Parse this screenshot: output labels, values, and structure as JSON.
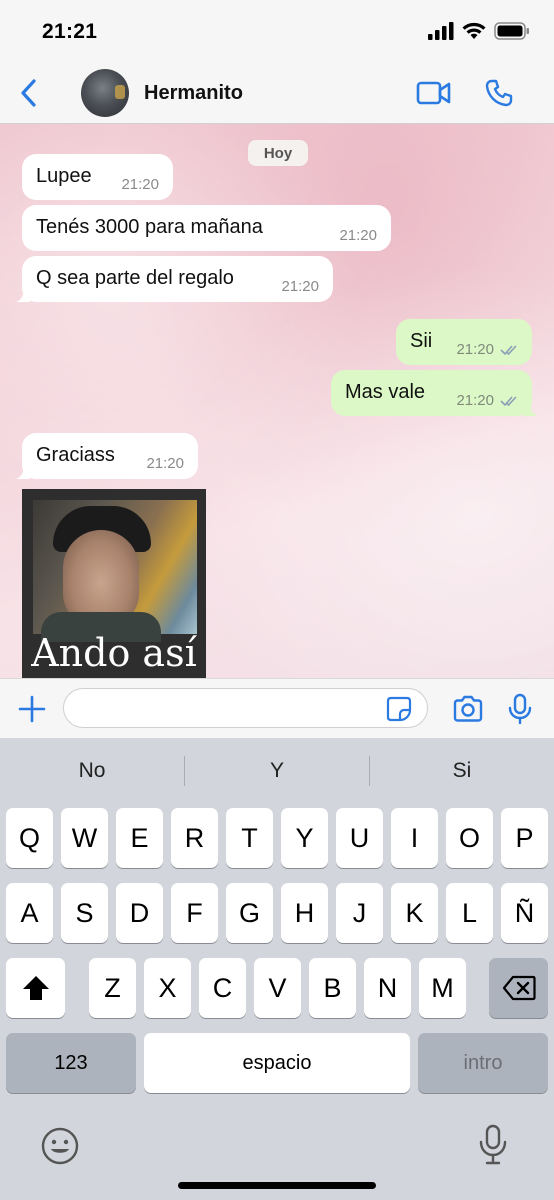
{
  "status_bar": {
    "time": "21:21"
  },
  "header": {
    "contact_name": "Hermanito"
  },
  "chat": {
    "date_chip": "Hoy",
    "messages": [
      {
        "direction": "incoming",
        "text": "Lupee",
        "time": "21:20"
      },
      {
        "direction": "incoming",
        "text": "Tenés 3000 para mañana",
        "time": "21:20"
      },
      {
        "direction": "incoming",
        "text": "Q sea parte del regalo",
        "time": "21:20"
      },
      {
        "direction": "outgoing",
        "text": "Sii",
        "time": "21:20",
        "read": true
      },
      {
        "direction": "outgoing",
        "text": "Mas vale",
        "time": "21:20",
        "read": true
      },
      {
        "direction": "incoming",
        "text": "Graciass",
        "time": "21:20"
      }
    ],
    "sticker": {
      "caption": "Ando así"
    }
  },
  "input_bar": {
    "value": ""
  },
  "keyboard": {
    "suggestions": [
      "No",
      "Y",
      "Si"
    ],
    "rows": [
      [
        "Q",
        "W",
        "E",
        "R",
        "T",
        "Y",
        "U",
        "I",
        "O",
        "P"
      ],
      [
        "A",
        "S",
        "D",
        "F",
        "G",
        "H",
        "J",
        "K",
        "L",
        "Ñ"
      ],
      [
        "Z",
        "X",
        "C",
        "V",
        "B",
        "N",
        "M"
      ]
    ],
    "numbers_key": "123",
    "space_key": "espacio",
    "return_key": "intro"
  },
  "colors": {
    "accent_blue": "#2a7ae2",
    "outgoing_bubble": "#dcf8c6",
    "incoming_bubble": "#ffffff",
    "read_ticks": "#8aa0b8"
  },
  "icons": {
    "status": [
      "signal-icon",
      "wifi-icon",
      "battery-icon"
    ],
    "header": [
      "back-chevron-icon",
      "video-call-icon",
      "phone-icon"
    ],
    "input": [
      "plus-icon",
      "sticker-icon",
      "camera-icon",
      "microphone-icon"
    ],
    "keyboard": [
      "shift-icon",
      "backspace-icon",
      "emoji-icon",
      "microphone-icon"
    ]
  }
}
